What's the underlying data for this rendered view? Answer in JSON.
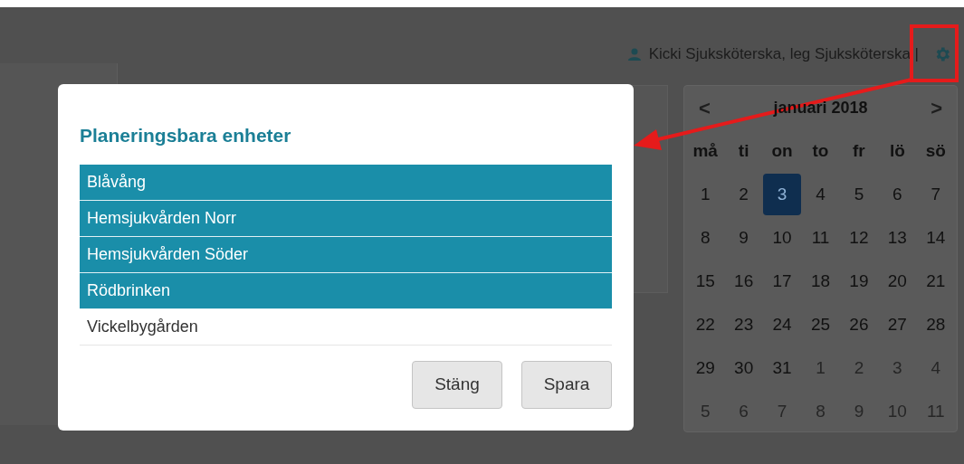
{
  "header": {
    "user": "Kicki Sjuksköterska, leg Sjuksköterska |"
  },
  "calendar": {
    "month": "januari 2018",
    "prev": "<",
    "next": ">",
    "weekdays": [
      "må",
      "ti",
      "on",
      "to",
      "fr",
      "lö",
      "sö"
    ],
    "weeks": [
      [
        {
          "day": "1",
          "selected": false,
          "other_month": false
        },
        {
          "day": "2",
          "selected": false,
          "other_month": false
        },
        {
          "day": "3",
          "selected": true,
          "other_month": false
        },
        {
          "day": "4",
          "selected": false,
          "other_month": false
        },
        {
          "day": "5",
          "selected": false,
          "other_month": false
        },
        {
          "day": "6",
          "selected": false,
          "other_month": false
        },
        {
          "day": "7",
          "selected": false,
          "other_month": false
        }
      ],
      [
        {
          "day": "8",
          "selected": false,
          "other_month": false
        },
        {
          "day": "9",
          "selected": false,
          "other_month": false
        },
        {
          "day": "10",
          "selected": false,
          "other_month": false
        },
        {
          "day": "11",
          "selected": false,
          "other_month": false
        },
        {
          "day": "12",
          "selected": false,
          "other_month": false
        },
        {
          "day": "13",
          "selected": false,
          "other_month": false
        },
        {
          "day": "14",
          "selected": false,
          "other_month": false
        }
      ],
      [
        {
          "day": "15",
          "selected": false,
          "other_month": false
        },
        {
          "day": "16",
          "selected": false,
          "other_month": false
        },
        {
          "day": "17",
          "selected": false,
          "other_month": false
        },
        {
          "day": "18",
          "selected": false,
          "other_month": false
        },
        {
          "day": "19",
          "selected": false,
          "other_month": false
        },
        {
          "day": "20",
          "selected": false,
          "other_month": false
        },
        {
          "day": "21",
          "selected": false,
          "other_month": false
        }
      ],
      [
        {
          "day": "22",
          "selected": false,
          "other_month": false
        },
        {
          "day": "23",
          "selected": false,
          "other_month": false
        },
        {
          "day": "24",
          "selected": false,
          "other_month": false
        },
        {
          "day": "25",
          "selected": false,
          "other_month": false
        },
        {
          "day": "26",
          "selected": false,
          "other_month": false
        },
        {
          "day": "27",
          "selected": false,
          "other_month": false
        },
        {
          "day": "28",
          "selected": false,
          "other_month": false
        }
      ],
      [
        {
          "day": "29",
          "selected": false,
          "other_month": false
        },
        {
          "day": "30",
          "selected": false,
          "other_month": false
        },
        {
          "day": "31",
          "selected": false,
          "other_month": false
        },
        {
          "day": "1",
          "selected": false,
          "other_month": true
        },
        {
          "day": "2",
          "selected": false,
          "other_month": true
        },
        {
          "day": "3",
          "selected": false,
          "other_month": true
        },
        {
          "day": "4",
          "selected": false,
          "other_month": true
        }
      ],
      [
        {
          "day": "5",
          "selected": false,
          "other_month": true
        },
        {
          "day": "6",
          "selected": false,
          "other_month": true
        },
        {
          "day": "7",
          "selected": false,
          "other_month": true
        },
        {
          "day": "8",
          "selected": false,
          "other_month": true
        },
        {
          "day": "9",
          "selected": false,
          "other_month": true
        },
        {
          "day": "10",
          "selected": false,
          "other_month": true
        },
        {
          "day": "11",
          "selected": false,
          "other_month": true
        }
      ]
    ]
  },
  "dialog": {
    "title": "Planeringsbara enheter",
    "units": [
      {
        "name": "Blåvång",
        "selected": true
      },
      {
        "name": "Hemsjukvården Norr",
        "selected": true
      },
      {
        "name": "Hemsjukvården Söder",
        "selected": true
      },
      {
        "name": "Rödbrinken",
        "selected": true
      },
      {
        "name": "Vickelbygården",
        "selected": false
      }
    ],
    "buttons": [
      "Stäng",
      "Spara"
    ]
  }
}
